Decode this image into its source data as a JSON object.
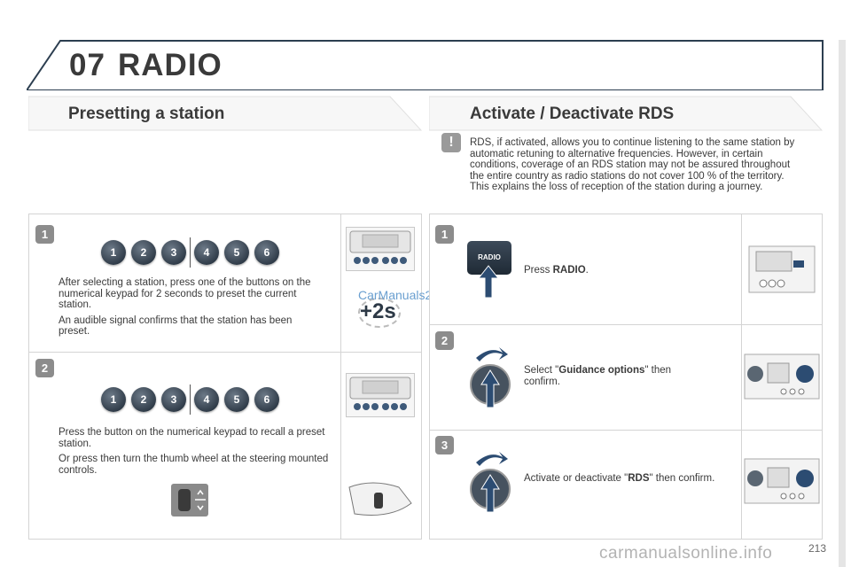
{
  "header": {
    "chapter_number": "07",
    "chapter_title": "RADIO"
  },
  "left_section": {
    "title": "Presetting a station",
    "steps": [
      {
        "number": "1",
        "keys": [
          "1",
          "2",
          "3",
          "4",
          "5",
          "6"
        ],
        "paragraphs": [
          "After selecting a station, press one of the buttons on the numerical keypad for 2 seconds to preset the current station.",
          "An audible signal confirms that the station has been preset."
        ],
        "hold_label": "+2s"
      },
      {
        "number": "2",
        "keys": [
          "1",
          "2",
          "3",
          "4",
          "5",
          "6"
        ],
        "paragraphs": [
          "Press the button on the numerical keypad to recall a preset station.",
          "Or press then turn the thumb wheel at the steering mounted controls."
        ]
      }
    ]
  },
  "right_section": {
    "title": "Activate / Deactivate RDS",
    "note": "RDS, if activated, allows you to continue listening to the same station by automatic retuning to alternative frequencies. However, in certain conditions, coverage of an RDS station may not be assured throughout the entire country as radio stations do not cover 100 % of the territory. This explains the loss of reception of the station during a journey.",
    "steps": [
      {
        "number": "1",
        "button_label": "RADIO",
        "pre": "Press ",
        "bold": "RADIO",
        "post": "."
      },
      {
        "number": "2",
        "pre": "Select \"",
        "bold": "Guidance options",
        "post": "\" then confirm."
      },
      {
        "number": "3",
        "pre": "Activate or deactivate \"",
        "bold": "RDS",
        "post": "\" then confirm."
      }
    ]
  },
  "watermark": "CarManuals2.com",
  "footer_watermark": "carmanualsonline.info",
  "page_number": "213",
  "colors": {
    "title": "#3a3a3a",
    "panel_border": "#d4d4d4",
    "badge": "#8c8c8c",
    "knob": "#2d3946",
    "watermark": "#6a9fd0"
  }
}
